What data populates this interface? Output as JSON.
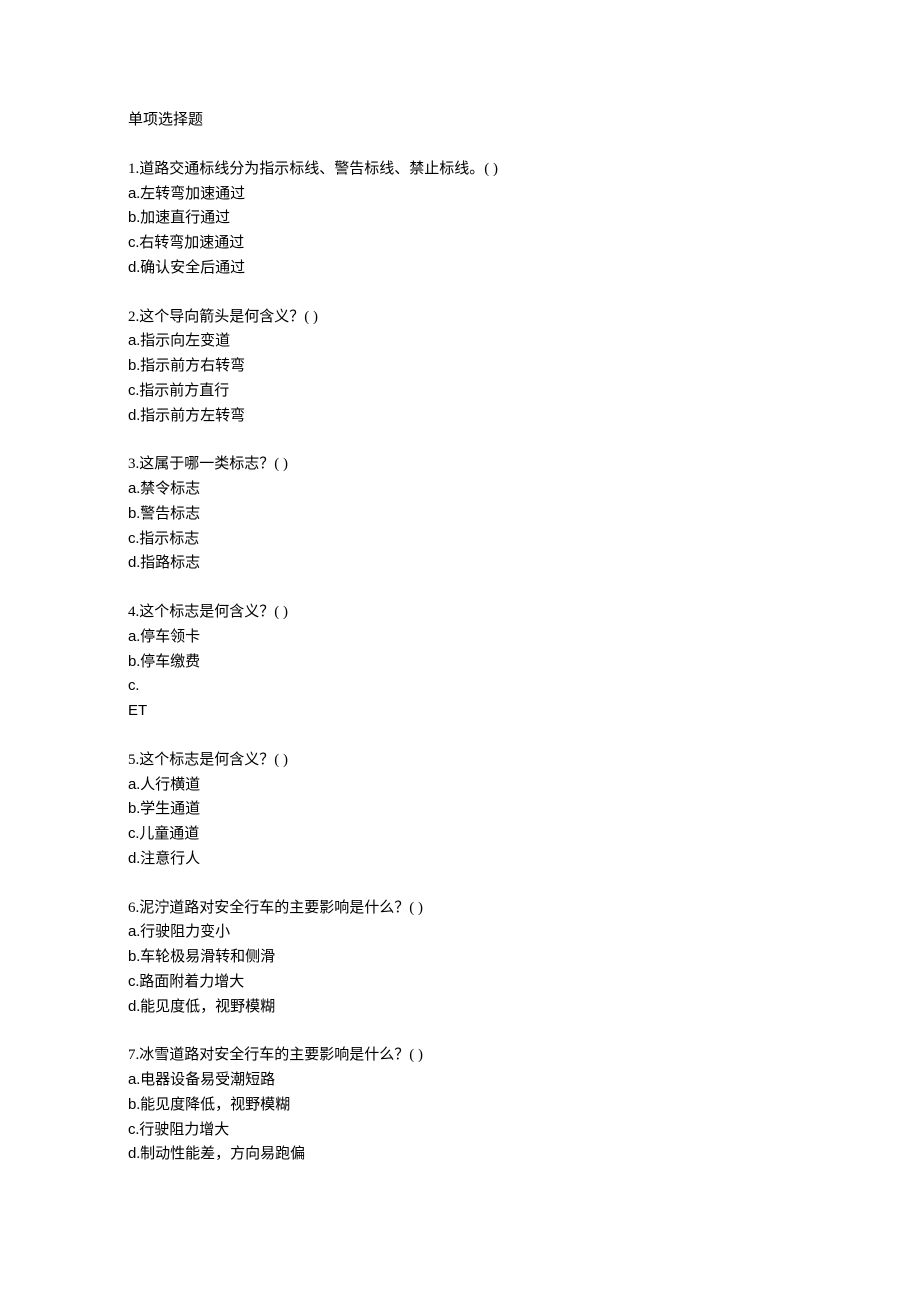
{
  "section_title": "单项选择题",
  "blank_marker": "(       )",
  "questions": [
    {
      "number": "1",
      "text": "道路交通标线分为指示标线、警告标线、禁止标线。",
      "options": [
        "左转弯加速通过",
        "加速直行通过",
        "右转弯加速通过",
        "确认安全后通过"
      ],
      "extra": null
    },
    {
      "number": "2",
      "text": "这个导向箭头是何含义？",
      "options": [
        "指示向左变道",
        "指示前方右转弯",
        "指示前方直行",
        "指示前方左转弯"
      ],
      "extra": null
    },
    {
      "number": "3",
      "text": "这属于哪一类标志？",
      "options": [
        "禁令标志",
        "警告标志",
        "指示标志",
        "指路标志"
      ],
      "extra": null
    },
    {
      "number": "4",
      "text": "这个标志是何含义？",
      "options": [
        "停车领卡",
        "停车缴费",
        ""
      ],
      "extra": "ET"
    },
    {
      "number": "5",
      "text": "这个标志是何含义？",
      "options": [
        "人行横道",
        "学生通道",
        "儿童通道",
        "注意行人"
      ],
      "extra": null
    },
    {
      "number": "6",
      "text": "泥泞道路对安全行车的主要影响是什么？",
      "options": [
        "行驶阻力变小",
        "车轮极易滑转和侧滑",
        "路面附着力增大",
        "能见度低，视野模糊"
      ],
      "extra": null
    },
    {
      "number": "7",
      "text": "冰雪道路对安全行车的主要影响是什么？",
      "options": [
        "电器设备易受潮短路",
        "能见度降低，视野模糊",
        "行驶阻力增大",
        "制动性能差，方向易跑偏"
      ],
      "extra": null
    }
  ],
  "option_labels": [
    "a",
    "b",
    "c",
    "d"
  ]
}
